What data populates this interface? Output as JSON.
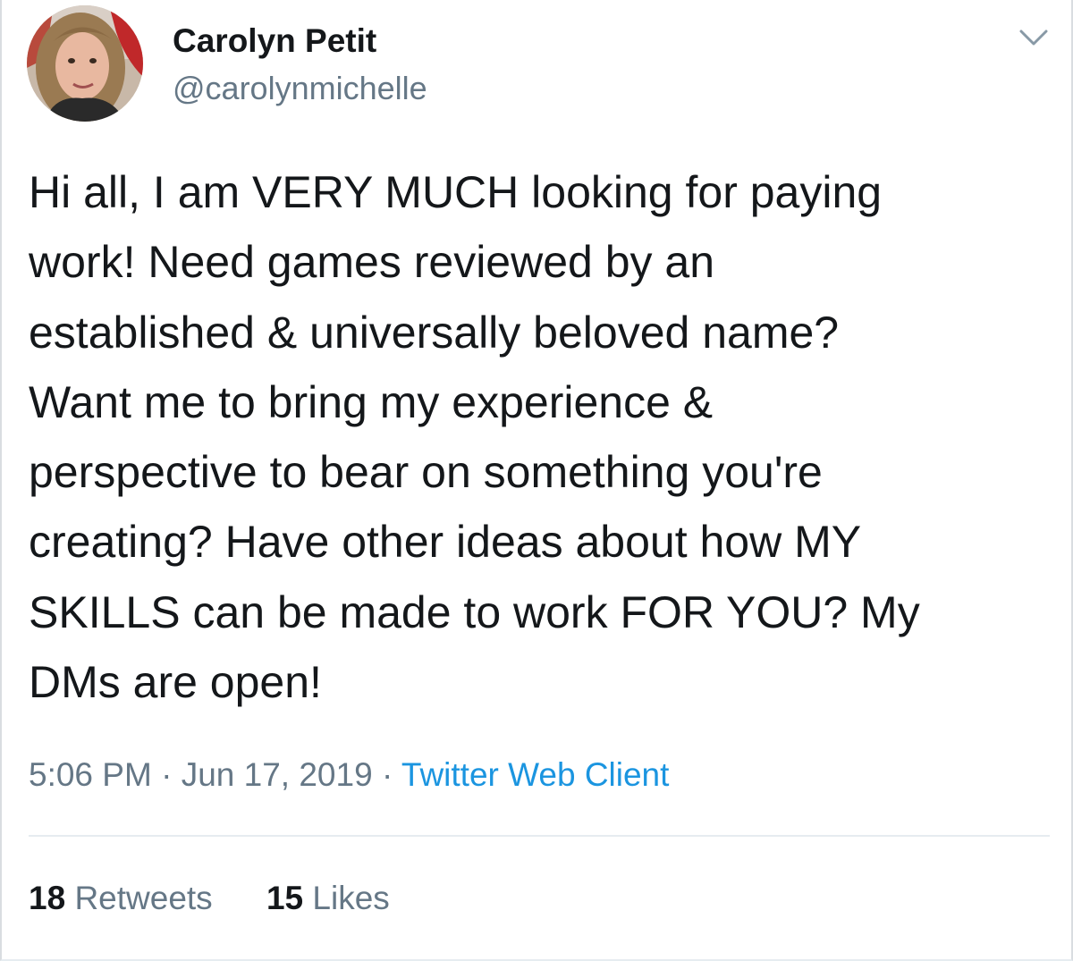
{
  "user": {
    "name": "Carolyn Petit",
    "handle": "@carolynmichelle"
  },
  "tweet": {
    "lines": [
      "Hi all, I am VERY MUCH looking for paying",
      "work! Need games reviewed by an",
      "established & universally beloved name?",
      "Want me to bring my experience &",
      "perspective to bear on something you're",
      "creating? Have other ideas about how MY",
      "SKILLS can be made to work FOR YOU? My",
      "DMs are open!"
    ],
    "time": "5:06 PM",
    "date": "Jun 17, 2019",
    "separator": "·",
    "client": "Twitter Web Client"
  },
  "stats": {
    "retweets_count": "18",
    "retweets_label": "Retweets",
    "likes_count": "15",
    "likes_label": "Likes"
  },
  "icons": {
    "menu": "chevron-down-icon",
    "avatar": "avatar"
  },
  "colors": {
    "text": "#14171a",
    "secondary": "#657786",
    "link": "#1b95e0",
    "divider": "#e6ecf0"
  }
}
